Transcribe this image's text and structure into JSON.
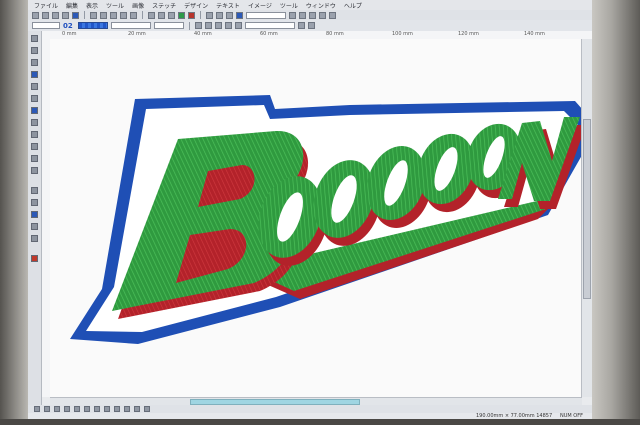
{
  "menubar": {
    "items": [
      "ファイル",
      "編集",
      "表示",
      "ツール",
      "画像",
      "ステッチ",
      "デザイン",
      "テキスト",
      "イメージ",
      "ツール",
      "ウィンドウ",
      "ヘルプ"
    ]
  },
  "toolbar2": {
    "layer_number": "02"
  },
  "ruler": {
    "labels": [
      "0 mm",
      "20 mm",
      "40 mm",
      "60 mm",
      "80 mm",
      "100 mm",
      "120 mm",
      "140 mm"
    ]
  },
  "design": {
    "text": "BOOOOON",
    "colors": {
      "outline": "#1f4fb5",
      "shadow": "#b3222a",
      "fill": "#2f9a3f",
      "white": "#ffffff"
    }
  },
  "status": {
    "size": "190.00mm × 77.00mm 14857",
    "num": "NUM OFF"
  }
}
